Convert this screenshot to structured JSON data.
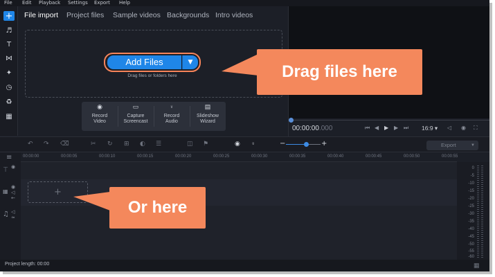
{
  "menu": [
    "File",
    "Edit",
    "Playback",
    "Settings",
    "Export",
    "Help"
  ],
  "tools": {
    "add": "+",
    "icons": [
      "music-icon",
      "text-icon",
      "transitions-icon",
      "magic-icon",
      "clock-icon",
      "stickers-icon",
      "more-icon"
    ]
  },
  "tabs": [
    "File import",
    "Project files",
    "Sample videos",
    "Backgrounds",
    "Intro videos"
  ],
  "import": {
    "add_files_label": "Add Files",
    "dropdown_icon": "chevron-down-icon",
    "hint": "Drag files or folders here"
  },
  "record": [
    {
      "line1": "Record",
      "line2": "Video",
      "icon": "webcam-icon"
    },
    {
      "line1": "Capture",
      "line2": "Screencast",
      "icon": "screen-icon"
    },
    {
      "line1": "Record",
      "line2": "Audio",
      "icon": "mic-icon"
    },
    {
      "line1": "Slideshow",
      "line2": "Wizard",
      "icon": "slideshow-icon"
    }
  ],
  "player": {
    "time_main": "00:00:00",
    "time_ms": ".000",
    "aspect": "16:9"
  },
  "timeline": {
    "ruler": [
      "00:00:00",
      "00:00:05",
      "00:00:10",
      "00:00:15",
      "00:00:20",
      "00:00:25",
      "00:00:30",
      "00:00:35",
      "00:00:40",
      "00:00:45",
      "00:00:50",
      "00:00:55"
    ],
    "export_label": "Export",
    "meter_scale": [
      "0",
      "-5",
      "-10",
      "-15",
      "-20",
      "-25",
      "-30",
      "-35",
      "-40",
      "-45",
      "-50",
      "-55",
      "-60"
    ],
    "drop_plus": "+"
  },
  "status": {
    "project_length": "Project length: 00:00"
  },
  "callouts": {
    "drag": "Drag files here",
    "or": "Or here"
  },
  "colors": {
    "accent": "#1f86e8",
    "callout": "#f4885c",
    "background": "#1c1f27"
  }
}
